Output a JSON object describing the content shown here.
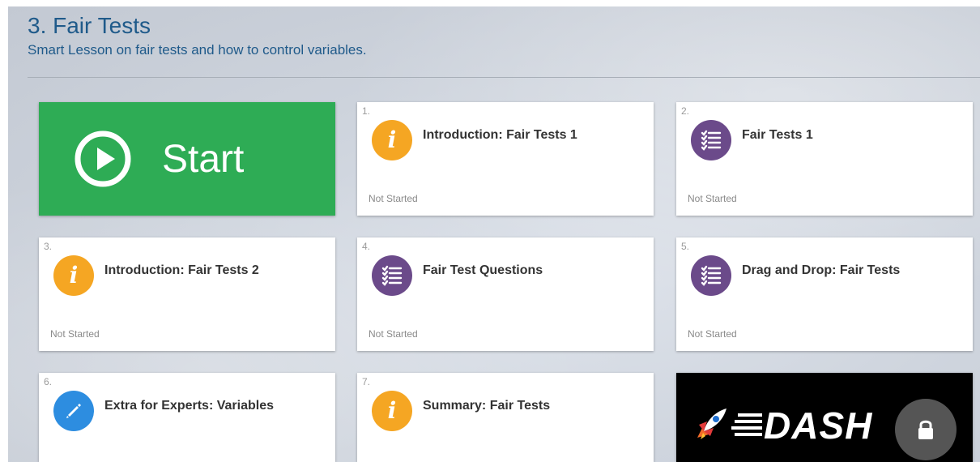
{
  "header": {
    "title": "3. Fair Tests",
    "subtitle": "Smart Lesson on fair tests and how to control variables."
  },
  "start": {
    "label": "Start"
  },
  "cards": [
    {
      "number": "1.",
      "title": "Introduction: Fair Tests 1",
      "status": "Not Started",
      "icon": "info-icon"
    },
    {
      "number": "2.",
      "title": "Fair Tests 1",
      "status": "Not Started",
      "icon": "checklist-icon"
    },
    {
      "number": "3.",
      "title": "Introduction: Fair Tests 2",
      "status": "Not Started",
      "icon": "info-icon"
    },
    {
      "number": "4.",
      "title": "Fair Test Questions",
      "status": "Not Started",
      "icon": "checklist-icon"
    },
    {
      "number": "5.",
      "title": "Drag and Drop: Fair Tests",
      "status": "Not Started",
      "icon": "checklist-icon"
    },
    {
      "number": "6.",
      "title": "Extra for Experts: Variables",
      "status": "",
      "icon": "pencil-icon"
    },
    {
      "number": "7.",
      "title": "Summary: Fair Tests",
      "status": "",
      "icon": "info-icon"
    }
  ],
  "dash": {
    "logo_text": "DASH",
    "icons": [
      "rocket-icon",
      "lock-icon"
    ]
  },
  "colors": {
    "accent_blue": "#1f5a8a",
    "start_green": "#2eac55",
    "info_orange": "#f5a623",
    "quiz_purple": "#6b4a8a",
    "edit_blue": "#2d8de0"
  }
}
